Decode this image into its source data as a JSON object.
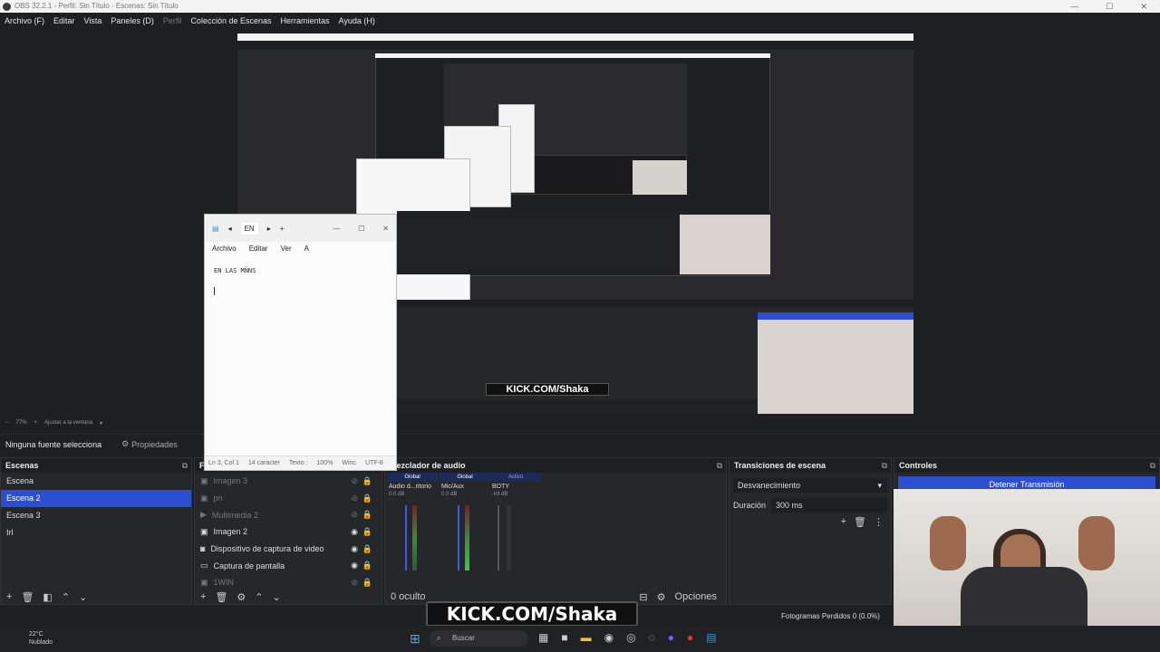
{
  "titlebar": {
    "title": "OBS 32.2.1 - Perfil: Sin Título - Escenas: Sin Título"
  },
  "menu": [
    "Archivo (F)",
    "Editar",
    "Vista",
    "Paneles (D)",
    "Perfil",
    "Colección de Escenas",
    "Herramientas",
    "Ayuda (H)"
  ],
  "zoom": {
    "value": "77%",
    "fit": "Ajustar a la ventana"
  },
  "propbar": {
    "no_source": "Ninguna fuente selecciona",
    "properties": "Propiedades"
  },
  "scenes": {
    "title": "Escenas",
    "items": [
      "Escena",
      "Escena 2",
      "Escena 3",
      "Irl"
    ],
    "selected": 1
  },
  "sources": {
    "title": "Fu",
    "items": [
      {
        "label": "Imagen 3",
        "hidden": true
      },
      {
        "label": "pn",
        "hidden": true
      },
      {
        "label": "Multimedia 2",
        "hidden": true
      },
      {
        "label": "Imagen 2",
        "hidden": false
      },
      {
        "label": "Dispositivo de captura de video",
        "hidden": false
      },
      {
        "label": "Captura de pantalla",
        "hidden": false
      },
      {
        "label": "1WIN",
        "hidden": true
      }
    ]
  },
  "mixer": {
    "title": "Mezclador de audio",
    "channels": [
      {
        "header": "Global",
        "name": "Audio d...ritorio",
        "db": "0.0 dB"
      },
      {
        "header": "Global",
        "name": "Mic/Aux",
        "db": "0.0 dB"
      },
      {
        "header": "Activo",
        "name": "BOTY",
        "db": "-inf dB"
      }
    ],
    "scale": [
      "-6",
      "-12",
      "-18",
      "-24",
      "-30",
      "-36",
      "-42",
      "-48",
      "-54",
      "-60"
    ],
    "hidden_count": "0 oculto",
    "options": "Opciones"
  },
  "transitions": {
    "title": "Transiciones de escena",
    "selected": "Desvanecimiento",
    "duration_label": "Duración",
    "duration_value": "300 ms"
  },
  "controls": {
    "title": "Controles",
    "stream_button": "Detener Transmisión"
  },
  "notepad": {
    "tab": "EN",
    "menu": [
      "Archivo",
      "Editar",
      "Ver"
    ],
    "text": "EN LAS MÑNS",
    "status": [
      "Ln 3, Col 1",
      "14 caracter",
      "Texto :",
      "100%",
      "Winc",
      "UTF-8"
    ]
  },
  "overlay": {
    "kick": "KICK.COM/Shaka"
  },
  "status": {
    "dropped_frames": "Fotogramas Perdidos 0 (0.0%)"
  },
  "weather": {
    "temp": "22°C",
    "desc": "Nublado"
  },
  "taskbar": {
    "search": "Buscar"
  },
  "colors": {
    "selection": "#2c4fd1",
    "panel": "#26272b",
    "bg": "#1e1f22"
  }
}
